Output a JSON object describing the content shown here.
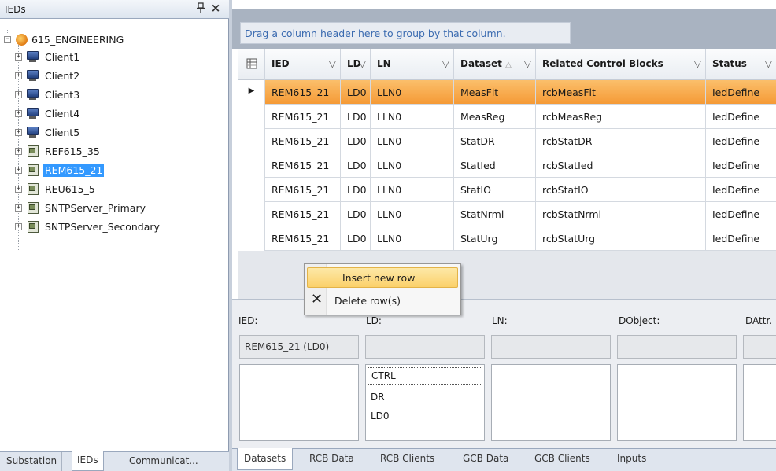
{
  "left_panel": {
    "title": "IEDs",
    "pin_glyph": "ᵖ",
    "close_glyph": "×",
    "tree": {
      "root": "615_ENGINEERING",
      "root_expander": "−",
      "children": [
        {
          "label": "Client1",
          "icon": "computer-icon"
        },
        {
          "label": "Client2",
          "icon": "computer-icon"
        },
        {
          "label": "Client3",
          "icon": "computer-icon"
        },
        {
          "label": "Client4",
          "icon": "computer-icon"
        },
        {
          "label": "Client5",
          "icon": "computer-icon"
        },
        {
          "label": "REF615_35",
          "icon": "ied-icon"
        },
        {
          "label": "REM615_21",
          "icon": "ied-icon",
          "selected": true
        },
        {
          "label": "REU615_5",
          "icon": "ied-icon"
        },
        {
          "label": "SNTPServer_Primary",
          "icon": "ied-icon"
        },
        {
          "label": "SNTPServer_Secondary",
          "icon": "ied-icon"
        }
      ],
      "child_expander": "+"
    },
    "tabs": [
      "Substation",
      "IEDs",
      "Communicat..."
    ]
  },
  "grid": {
    "group_hint": "Drag a column header here to group by that column.",
    "columns": [
      "IED",
      "LD",
      "LN",
      "Dataset",
      "Related Control Blocks",
      "Status"
    ],
    "filter_glyph": "▽",
    "sort_glyph": "△",
    "row_indicator": "▶",
    "rows": [
      [
        "REM615_21",
        "LD0",
        "LLN0",
        "MeasFlt",
        "rcbMeasFlt",
        "IedDefine"
      ],
      [
        "REM615_21",
        "LD0",
        "LLN0",
        "MeasReg",
        "rcbMeasReg",
        "IedDefine"
      ],
      [
        "REM615_21",
        "LD0",
        "LLN0",
        "StatDR",
        "rcbStatDR",
        "IedDefine"
      ],
      [
        "REM615_21",
        "LD0",
        "LLN0",
        "StatIed",
        "rcbStatIed",
        "IedDefine"
      ],
      [
        "REM615_21",
        "LD0",
        "LLN0",
        "StatIO",
        "rcbStatIO",
        "IedDefine"
      ],
      [
        "REM615_21",
        "LD0",
        "LLN0",
        "StatNrml",
        "rcbStatNrml",
        "IedDefine"
      ],
      [
        "REM615_21",
        "LD0",
        "LLN0",
        "StatUrg",
        "rcbStatUrg",
        "IedDefine"
      ]
    ],
    "selected_row": 0
  },
  "context_menu": {
    "insert": "Insert new row",
    "delete": "Delete row(s)",
    "delete_glyph": "✕"
  },
  "detail": {
    "labels": {
      "ied": "IED:",
      "ld": "LD:",
      "ln": "LN:",
      "dobject": "DObject:",
      "dattr": "DAttr."
    },
    "ied_value": "REM615_21 (LD0)",
    "ld_list": [
      "CTRL",
      "DR",
      "LD0"
    ]
  },
  "bottom_tabs": [
    "Datasets",
    "RCB Data",
    "RCB Clients",
    "GCB Data",
    "GCB Clients",
    "Inputs"
  ],
  "colors": {
    "selection_row": "#f59a36",
    "tree_selection": "#3399ff",
    "group_hint_text": "#3b6bb0"
  }
}
